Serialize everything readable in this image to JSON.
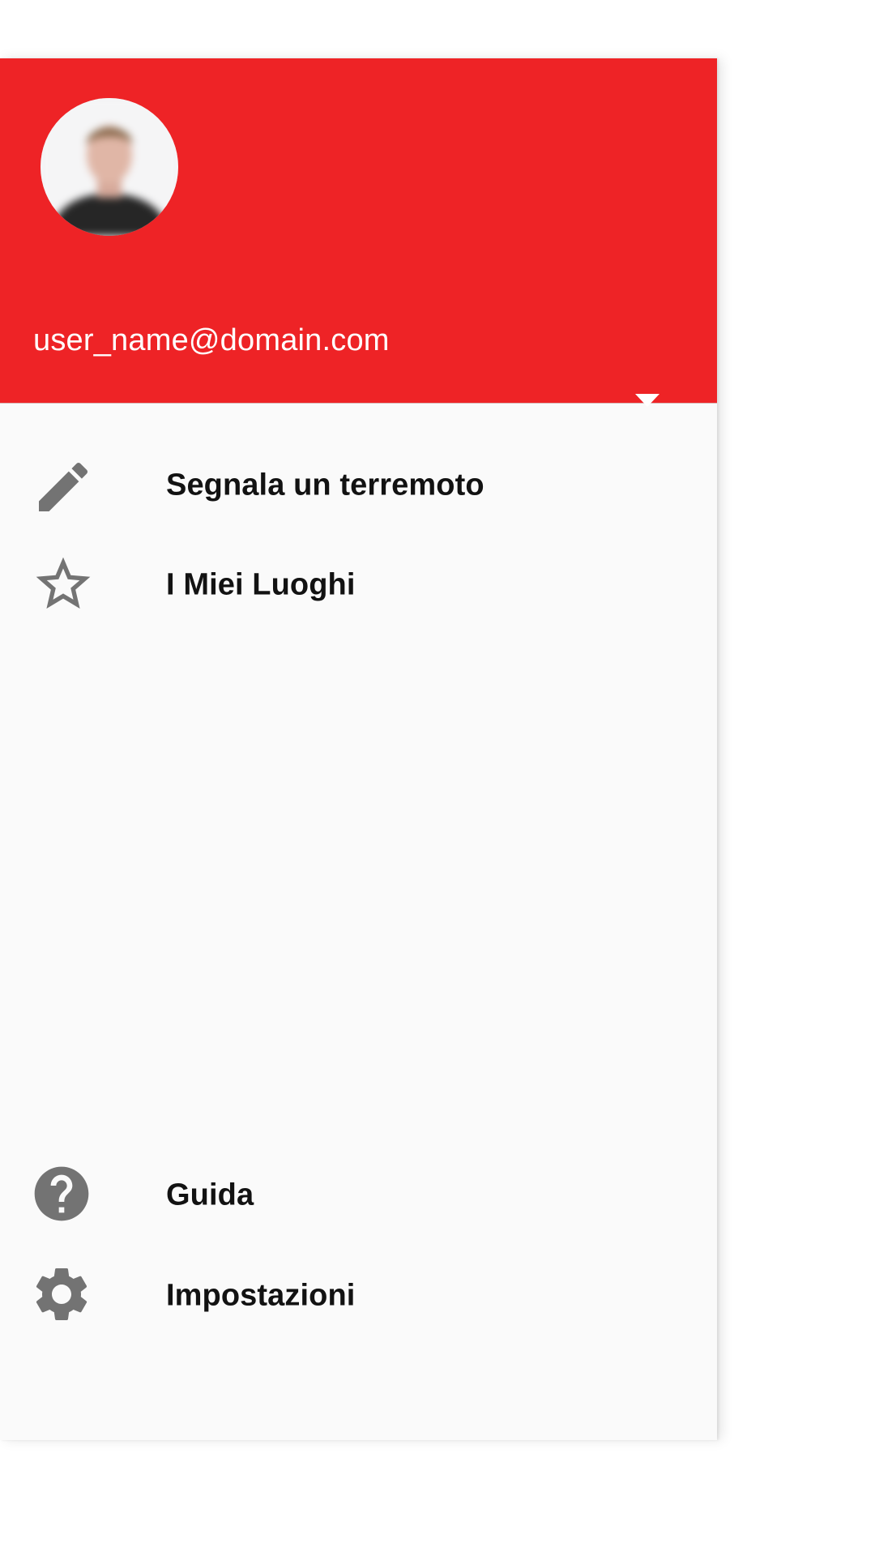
{
  "account": {
    "email": "user_name@domain.com",
    "avatar": "user-avatar-photo",
    "switch_icon": "arrow-drop-down-icon"
  },
  "menu": {
    "top_items": [
      {
        "label": "Segnala un terremoto",
        "icon": "pencil-icon"
      },
      {
        "label": "I Miei Luoghi",
        "icon": "star-outline-icon"
      }
    ],
    "bottom_items": [
      {
        "label": "Guida",
        "icon": "help-circle-icon"
      },
      {
        "label": "Impostazioni",
        "icon": "gear-icon"
      }
    ]
  },
  "colors": {
    "header_red": "#ee2326",
    "drawer_background": "#fafafa",
    "icon_gray": "#737373",
    "text": "#121212"
  }
}
